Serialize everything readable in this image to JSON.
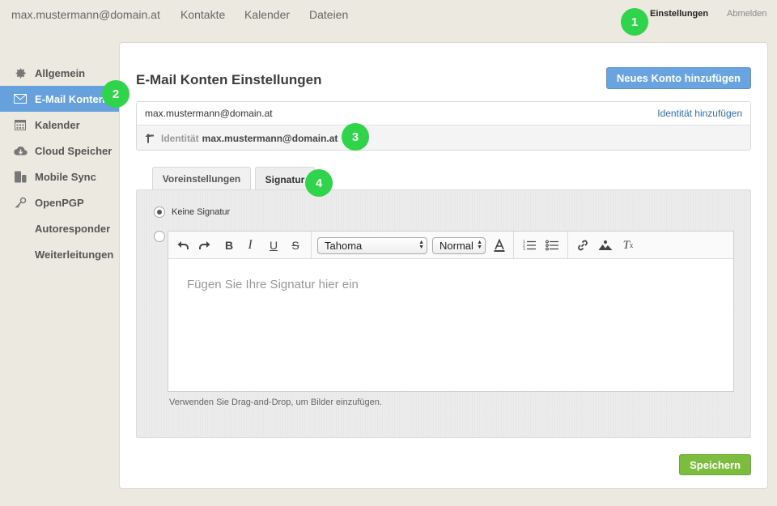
{
  "topnav": {
    "user_email": "max.mustermann@domain.at",
    "items": [
      "Kontakte",
      "Kalender",
      "Dateien"
    ],
    "settings_label": "Einstellungen",
    "logout_label": "Abmelden"
  },
  "badges": [
    "1",
    "2",
    "3",
    "4"
  ],
  "sidebar": {
    "items": [
      {
        "label": "Allgemein",
        "icon": "gear-icon"
      },
      {
        "label": "E-Mail Konten",
        "icon": "envelope-icon"
      },
      {
        "label": "Kalender",
        "icon": "calendar-icon"
      },
      {
        "label": "Cloud Speicher",
        "icon": "cloud-download-icon"
      },
      {
        "label": "Mobile Sync",
        "icon": "mobile-sync-icon"
      },
      {
        "label": "OpenPGP",
        "icon": "key-icon"
      },
      {
        "label": "Autoresponder"
      },
      {
        "label": "Weiterleitungen"
      }
    ],
    "active_index": 1
  },
  "main": {
    "title": "E-Mail Konten Einstellungen",
    "add_account_button": "Neues Konto hinzufügen",
    "account": {
      "email": "max.mustermann@domain.at",
      "add_identity_link": "Identität hinzufügen",
      "identity_label": "Identität",
      "identity_value": "max.mustermann@domain.at"
    },
    "tabs": [
      {
        "label": "Voreinstellungen",
        "active": false
      },
      {
        "label": "Signatur",
        "active": true
      }
    ],
    "signature": {
      "no_signature_label": "Keine Signatur",
      "font_select": "Tahoma",
      "size_select": "Normal",
      "editor_placeholder": "Fügen Sie Ihre Signatur hier ein",
      "hint": "Verwenden Sie Drag-and-Drop, um Bilder einzufügen."
    },
    "save_button": "Speichern"
  },
  "colors": {
    "accent_blue": "#67a1dd",
    "save_green": "#7cbd3d",
    "badge_green": "#2fd44a",
    "background": "#ece9e0"
  }
}
